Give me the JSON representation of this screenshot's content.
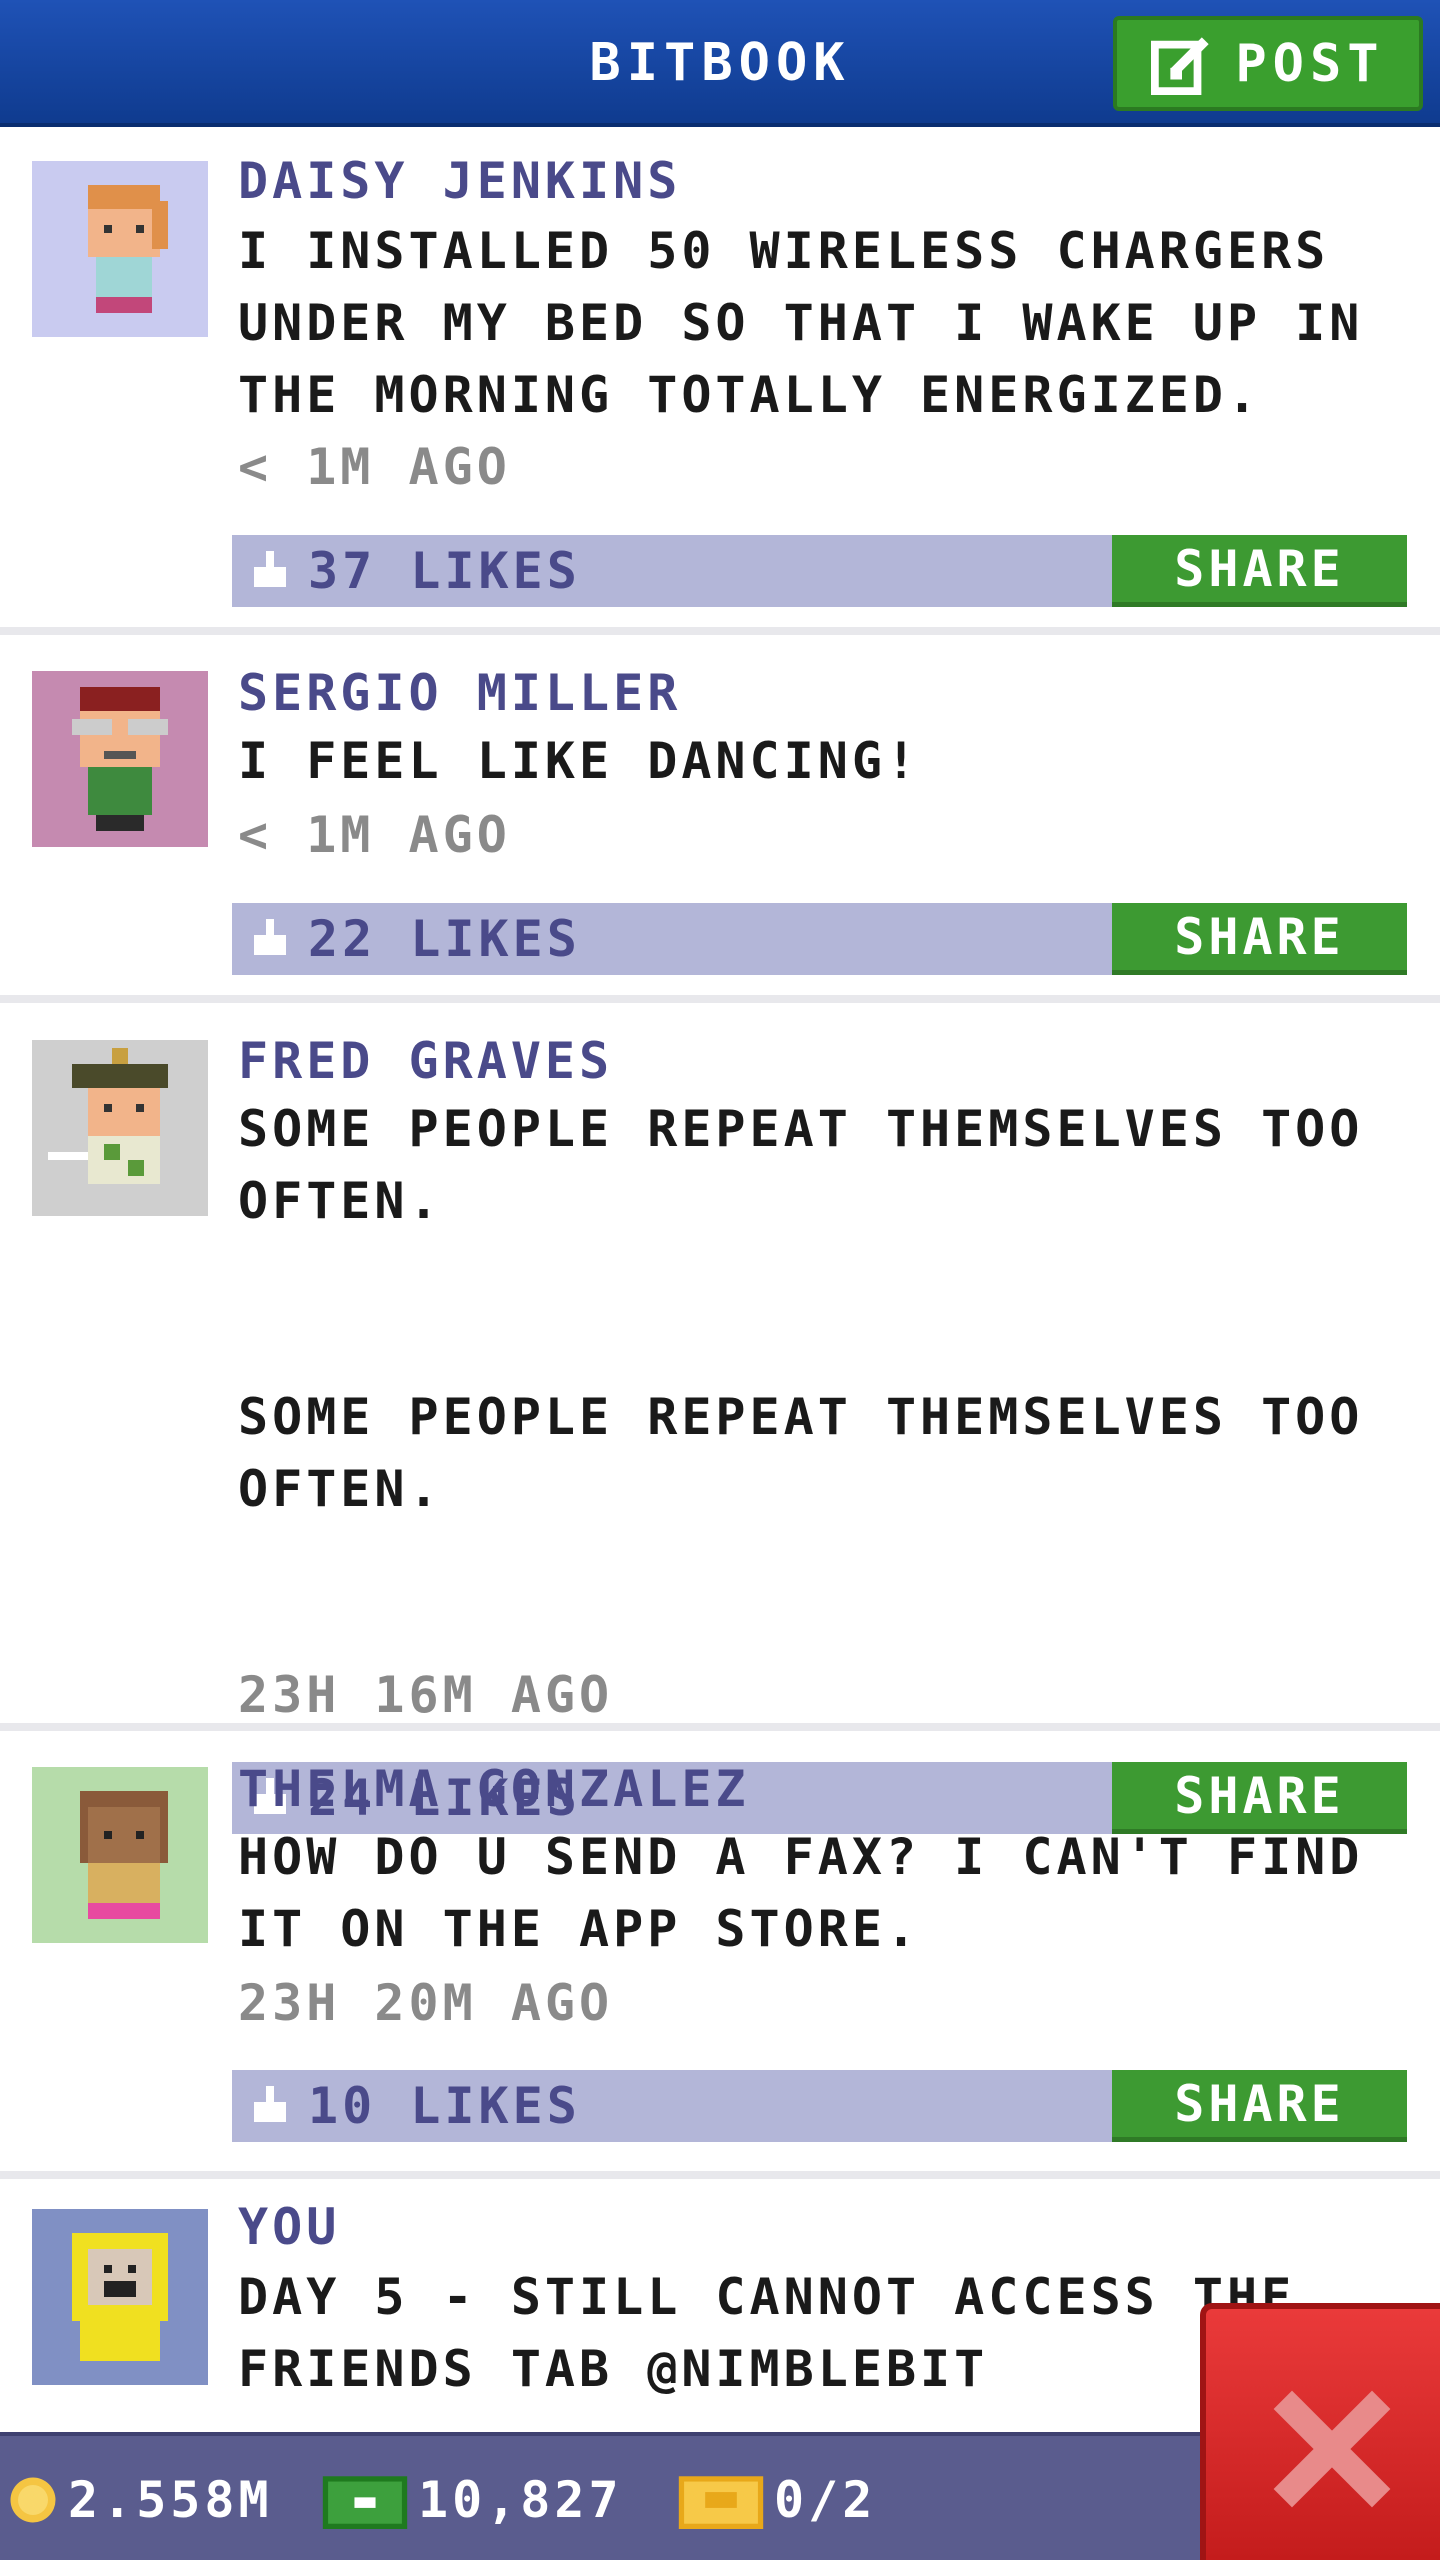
{
  "header": {
    "title": "BITBOOK",
    "post_label": "POST"
  },
  "posts": [
    {
      "author": "DAISY JENKINS",
      "text": "I INSTALLED 50 WIRELESS CHARGERS\nUNDER MY BED SO THAT I WAKE UP IN\nTHE MORNING TOTALLY ENERGIZED.",
      "time": "< 1M AGO",
      "likes": "37 LIKES",
      "share": "SHARE",
      "avatar_bg": "#c9cbf0"
    },
    {
      "author": "SERGIO MILLER",
      "text": "I FEEL LIKE DANCING!",
      "time": "< 1M AGO",
      "likes": "22 LIKES",
      "share": "SHARE",
      "avatar_bg": "#c58ab0"
    },
    {
      "author": "FRED GRAVES",
      "text": "SOME PEOPLE REPEAT THEMSELVES TOO\nOFTEN.\n\n\nSOME PEOPLE REPEAT THEMSELVES TOO\nOFTEN.",
      "time": "23H 16M AGO",
      "likes": "24 LIKES",
      "share": "SHARE",
      "avatar_bg": "#cfcfcf"
    },
    {
      "author": "THELMA GONZALEZ",
      "text": "HOW DO U SEND A FAX? I CAN'T FIND\nIT ON THE APP STORE.",
      "time": "23H 20M AGO",
      "likes": "10 LIKES",
      "share": "SHARE",
      "avatar_bg": "#b6dcaa"
    },
    {
      "author": "YOU",
      "text": "DAY 5 - STILL CANNOT ACCESS THE\nFRIENDS TAB @NIMBLEBIT",
      "time": "",
      "likes": "",
      "share": "",
      "avatar_bg": "#8090c4"
    }
  ],
  "status_bar": {
    "coins": "2.558M",
    "bux": "10,827",
    "tickets": "0/2"
  },
  "colors": {
    "header": "#1f52b6",
    "accent_green": "#3d9a32",
    "like_bar": "#b3b6d8",
    "close_red": "#d42424"
  },
  "icons": [
    "post-edit-icon",
    "like-thumb-icon",
    "coin-icon",
    "bux-icon",
    "ticket-icon",
    "close-x-icon"
  ]
}
